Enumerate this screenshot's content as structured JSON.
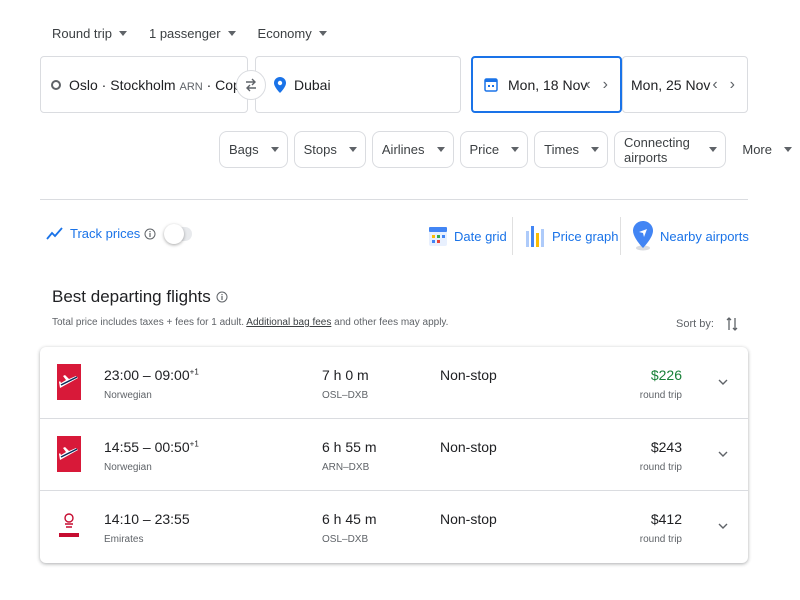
{
  "search": {
    "trip_type": "Round trip",
    "passengers": "1 passenger",
    "cabin": "Economy",
    "from_main": "Oslo · Stockholm",
    "from_code": "ARN",
    "from_rest": "· Copenh...",
    "to": "Dubai",
    "depart_date": "Mon, 18 Nov",
    "return_date": "Mon, 25 Nov"
  },
  "filters": [
    "Bags",
    "Stops",
    "Airlines",
    "Price",
    "Times",
    "Connecting airports",
    "More"
  ],
  "tools": {
    "track_prices": "Track prices",
    "date_grid": "Date grid",
    "price_graph": "Price graph",
    "nearby_airports": "Nearby airports"
  },
  "section": {
    "title": "Best departing flights",
    "note_prefix": "Total price includes taxes + fees for 1 adult. ",
    "note_link": "Additional bag fees",
    "note_suffix": " and other fees may apply.",
    "sort_label": "Sort by:"
  },
  "flights": [
    {
      "times": "23:00 – 09:00",
      "plus": "+1",
      "airline": "Norwegian",
      "duration": "7 h 0 m",
      "route": "OSL–DXB",
      "stops": "Non-stop",
      "price": "$226",
      "price_type": "round trip"
    },
    {
      "times": "14:55 – 00:50",
      "plus": "+1",
      "airline": "Norwegian",
      "duration": "6 h 55 m",
      "route": "ARN–DXB",
      "stops": "Non-stop",
      "price": "$243",
      "price_type": "round trip"
    },
    {
      "times": "14:10 – 23:55",
      "plus": "",
      "airline": "Emirates",
      "duration": "6 h 45 m",
      "route": "OSL–DXB",
      "stops": "Non-stop",
      "price": "$412",
      "price_type": "round trip"
    }
  ],
  "colors": {
    "accent": "#1a73e8",
    "cheap_price": "#188038",
    "norwegian_red": "#d81939",
    "emirates_red": "#c60c30"
  },
  "icons": [
    "caret-down-icon",
    "origin-circle-icon",
    "swap-icon",
    "location-pin-icon",
    "calendar-icon",
    "chevron-left-icon",
    "chevron-right-icon",
    "trend-icon",
    "info-icon",
    "date-grid-icon",
    "price-graph-icon",
    "nearby-airports-icon",
    "sort-icon",
    "expand-chevron-icon"
  ]
}
